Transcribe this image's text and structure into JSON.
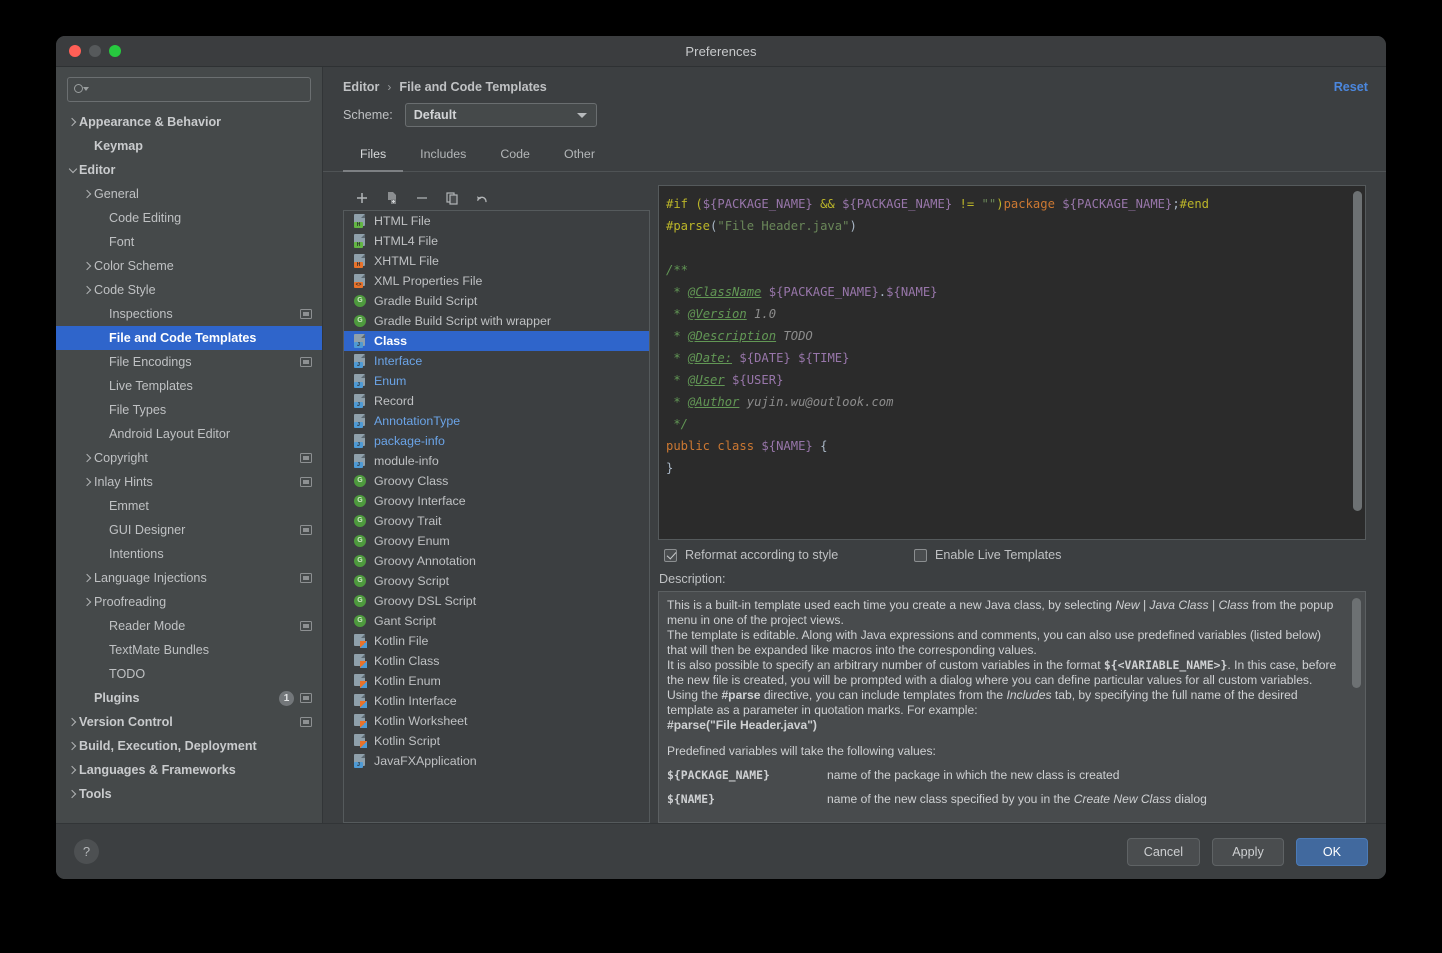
{
  "window": {
    "title": "Preferences",
    "traffic_lights": [
      "close-light",
      "minimize-light",
      "maximize-light"
    ]
  },
  "sidebar": {
    "search": {
      "value": "",
      "placeholder": ""
    },
    "items": [
      {
        "label": "Appearance & Behavior",
        "indent": 0,
        "arrow": "right",
        "bold": true
      },
      {
        "label": "Keymap",
        "indent": 1,
        "arrow": "",
        "bold": true
      },
      {
        "label": "Editor",
        "indent": 0,
        "arrow": "down",
        "bold": true
      },
      {
        "label": "General",
        "indent": 1,
        "arrow": "right"
      },
      {
        "label": "Code Editing",
        "indent": 2,
        "arrow": ""
      },
      {
        "label": "Font",
        "indent": 2,
        "arrow": ""
      },
      {
        "label": "Color Scheme",
        "indent": 1,
        "arrow": "right"
      },
      {
        "label": "Code Style",
        "indent": 1,
        "arrow": "right"
      },
      {
        "label": "Inspections",
        "indent": 2,
        "arrow": "",
        "project": true
      },
      {
        "label": "File and Code Templates",
        "indent": 2,
        "arrow": "",
        "selected": true
      },
      {
        "label": "File Encodings",
        "indent": 2,
        "arrow": "",
        "project": true
      },
      {
        "label": "Live Templates",
        "indent": 2,
        "arrow": ""
      },
      {
        "label": "File Types",
        "indent": 2,
        "arrow": ""
      },
      {
        "label": "Android Layout Editor",
        "indent": 2,
        "arrow": ""
      },
      {
        "label": "Copyright",
        "indent": 1,
        "arrow": "right",
        "project": true
      },
      {
        "label": "Inlay Hints",
        "indent": 1,
        "arrow": "right",
        "project": true
      },
      {
        "label": "Emmet",
        "indent": 2,
        "arrow": ""
      },
      {
        "label": "GUI Designer",
        "indent": 2,
        "arrow": "",
        "project": true
      },
      {
        "label": "Intentions",
        "indent": 2,
        "arrow": ""
      },
      {
        "label": "Language Injections",
        "indent": 1,
        "arrow": "right",
        "project": true
      },
      {
        "label": "Proofreading",
        "indent": 1,
        "arrow": "right"
      },
      {
        "label": "Reader Mode",
        "indent": 2,
        "arrow": "",
        "project": true
      },
      {
        "label": "TextMate Bundles",
        "indent": 2,
        "arrow": ""
      },
      {
        "label": "TODO",
        "indent": 2,
        "arrow": ""
      },
      {
        "label": "Plugins",
        "indent": 1,
        "arrow": "",
        "bold": true,
        "count": "1",
        "project": true
      },
      {
        "label": "Version Control",
        "indent": 0,
        "arrow": "right",
        "bold": true,
        "project": true
      },
      {
        "label": "Build, Execution, Deployment",
        "indent": 0,
        "arrow": "right",
        "bold": true
      },
      {
        "label": "Languages & Frameworks",
        "indent": 0,
        "arrow": "right",
        "bold": true
      },
      {
        "label": "Tools",
        "indent": 0,
        "arrow": "right",
        "bold": true
      }
    ]
  },
  "header": {
    "breadcrumb_parent": "Editor",
    "breadcrumb_sep": "›",
    "breadcrumb_current": "File and Code Templates",
    "reset_label": "Reset",
    "scheme_label": "Scheme:",
    "scheme_value": "Default"
  },
  "tabs": [
    {
      "label": "Files",
      "active": true
    },
    {
      "label": "Includes",
      "active": false
    },
    {
      "label": "Code",
      "active": false
    },
    {
      "label": "Other",
      "active": false
    }
  ],
  "list_toolbar": [
    {
      "icon": "plus-icon",
      "title": "Add"
    },
    {
      "icon": "copy-template-icon",
      "title": "Copy Template"
    },
    {
      "icon": "minus-icon",
      "title": "Remove"
    },
    {
      "icon": "clone-icon",
      "title": "Clone"
    },
    {
      "icon": "reset-undo-icon",
      "title": "Reset to Default"
    }
  ],
  "templates": [
    {
      "label": "HTML File",
      "icon": "html-file-icon",
      "tag": "H",
      "tagcolor": "green",
      "kind": "page"
    },
    {
      "label": "HTML4 File",
      "icon": "html4-file-icon",
      "tag": "H",
      "tagcolor": "green",
      "kind": "page"
    },
    {
      "label": "XHTML File",
      "icon": "xhtml-file-icon",
      "tag": "H",
      "tagcolor": "orange",
      "kind": "page"
    },
    {
      "label": "XML Properties File",
      "icon": "xml-properties-file-icon",
      "tag": "<>",
      "tagcolor": "orange",
      "kind": "page"
    },
    {
      "label": "Gradle Build Script",
      "icon": "groovy-icon",
      "kind": "circle",
      "tag": "G"
    },
    {
      "label": "Gradle Build Script with wrapper",
      "icon": "groovy-icon",
      "kind": "circle",
      "tag": "G"
    },
    {
      "label": "Class",
      "icon": "java-class-icon",
      "tag": "J",
      "tagcolor": "blue",
      "kind": "page",
      "selected": true
    },
    {
      "label": "Interface",
      "icon": "java-interface-icon",
      "tag": "J",
      "tagcolor": "blue",
      "kind": "page",
      "blue": true
    },
    {
      "label": "Enum",
      "icon": "java-enum-icon",
      "tag": "J",
      "tagcolor": "blue",
      "kind": "page",
      "blue": true
    },
    {
      "label": "Record",
      "icon": "java-record-icon",
      "tag": "J",
      "tagcolor": "blue",
      "kind": "page"
    },
    {
      "label": "AnnotationType",
      "icon": "java-annotation-icon",
      "tag": "J",
      "tagcolor": "blue",
      "kind": "page",
      "blue": true
    },
    {
      "label": "package-info",
      "icon": "java-package-info-icon",
      "tag": "J",
      "tagcolor": "blue",
      "kind": "page",
      "blue": true
    },
    {
      "label": "module-info",
      "icon": "java-module-info-icon",
      "tag": "J",
      "tagcolor": "blue",
      "kind": "page"
    },
    {
      "label": "Groovy Class",
      "icon": "groovy-icon",
      "kind": "circle",
      "tag": "G"
    },
    {
      "label": "Groovy Interface",
      "icon": "groovy-icon",
      "kind": "circle",
      "tag": "G"
    },
    {
      "label": "Groovy Trait",
      "icon": "groovy-icon",
      "kind": "circle",
      "tag": "G"
    },
    {
      "label": "Groovy Enum",
      "icon": "groovy-icon",
      "kind": "circle",
      "tag": "G"
    },
    {
      "label": "Groovy Annotation",
      "icon": "groovy-icon",
      "kind": "circle",
      "tag": "G"
    },
    {
      "label": "Groovy Script",
      "icon": "groovy-icon",
      "kind": "circle",
      "tag": "G"
    },
    {
      "label": "Groovy DSL Script",
      "icon": "groovy-icon",
      "kind": "circle",
      "tag": "G"
    },
    {
      "label": "Gant Script",
      "icon": "groovy-icon",
      "kind": "circle",
      "tag": "G"
    },
    {
      "label": "Kotlin File",
      "icon": "kotlin-file-icon",
      "kind": "kotlin"
    },
    {
      "label": "Kotlin Class",
      "icon": "kotlin-class-icon",
      "kind": "kotlin"
    },
    {
      "label": "Kotlin Enum",
      "icon": "kotlin-enum-icon",
      "kind": "kotlin"
    },
    {
      "label": "Kotlin Interface",
      "icon": "kotlin-interface-icon",
      "kind": "kotlin"
    },
    {
      "label": "Kotlin Worksheet",
      "icon": "kotlin-worksheet-icon",
      "kind": "kotlin"
    },
    {
      "label": "Kotlin Script",
      "icon": "kotlin-script-icon",
      "kind": "kotlin"
    },
    {
      "label": "JavaFXApplication",
      "icon": "javafx-application-icon",
      "tag": "J",
      "tagcolor": "blue",
      "kind": "page"
    }
  ],
  "editor": {
    "code_lines": [
      [
        {
          "t": "#if (",
          "c": "k-dir"
        },
        {
          "t": "${PACKAGE_NAME}",
          "c": "k-var"
        },
        {
          "t": " && ",
          "c": "k-dir"
        },
        {
          "t": "${PACKAGE_NAME}",
          "c": "k-var"
        },
        {
          "t": " != ",
          "c": "k-dir"
        },
        {
          "t": "\"\"",
          "c": "k-str"
        },
        {
          "t": ")",
          "c": "k-dir"
        },
        {
          "t": "package ",
          "c": "k-kw"
        },
        {
          "t": "${PACKAGE_NAME}",
          "c": "k-var"
        },
        {
          "t": ";",
          "c": "k-plain"
        },
        {
          "t": "#end",
          "c": "k-dir"
        }
      ],
      [
        {
          "t": "#parse",
          "c": "k-dir"
        },
        {
          "t": "(",
          "c": "k-plain"
        },
        {
          "t": "\"File Header.java\"",
          "c": "k-str"
        },
        {
          "t": ")",
          "c": "k-plain"
        }
      ],
      [],
      [
        {
          "t": "/**",
          "c": "k-cmt"
        }
      ],
      [
        {
          "t": " * ",
          "c": "k-cmt"
        },
        {
          "t": "@ClassName",
          "c": "k-tag"
        },
        {
          "t": " ",
          "c": "k-doc"
        },
        {
          "t": "${PACKAGE_NAME}",
          "c": "k-var"
        },
        {
          "t": ".",
          "c": "k-plain"
        },
        {
          "t": "${NAME}",
          "c": "k-var"
        }
      ],
      [
        {
          "t": " * ",
          "c": "k-cmt"
        },
        {
          "t": "@Version",
          "c": "k-tag"
        },
        {
          "t": " 1.0",
          "c": "k-doc"
        }
      ],
      [
        {
          "t": " * ",
          "c": "k-cmt"
        },
        {
          "t": "@Description",
          "c": "k-tag"
        },
        {
          "t": " TODO",
          "c": "k-doc"
        }
      ],
      [
        {
          "t": " * ",
          "c": "k-cmt"
        },
        {
          "t": "@Date:",
          "c": "k-tag"
        },
        {
          "t": " ",
          "c": "k-doc"
        },
        {
          "t": "${DATE}",
          "c": "k-var"
        },
        {
          "t": " ",
          "c": "k-doc"
        },
        {
          "t": "${TIME}",
          "c": "k-var"
        }
      ],
      [
        {
          "t": " * ",
          "c": "k-cmt"
        },
        {
          "t": "@User",
          "c": "k-tag"
        },
        {
          "t": " ",
          "c": "k-doc"
        },
        {
          "t": "${USER}",
          "c": "k-var"
        }
      ],
      [
        {
          "t": " * ",
          "c": "k-cmt"
        },
        {
          "t": "@Author",
          "c": "k-tag"
        },
        {
          "t": " yujin.wu@outlook.com",
          "c": "k-doc"
        }
      ],
      [
        {
          "t": " */",
          "c": "k-cmt"
        }
      ],
      [
        {
          "t": "public class ",
          "c": "k-kw"
        },
        {
          "t": "${NAME}",
          "c": "k-var"
        },
        {
          "t": " {",
          "c": "k-plain"
        }
      ],
      [
        {
          "t": "}",
          "c": "k-plain"
        }
      ]
    ],
    "checkbox_reformat": {
      "label": "Reformat according to style",
      "checked": true
    },
    "checkbox_live_templates": {
      "label": "Enable Live Templates",
      "checked": false
    },
    "description_label": "Description:"
  },
  "description": {
    "p1_a": "This is a built-in template used each time you create a new Java class, by selecting ",
    "p1_i1": "New | Java Class | Class",
    "p1_b": " from the popup menu in one of the project views.",
    "p2": "The template is editable. Along with Java expressions and comments, you can also use predefined variables (listed below) that will then be expanded like macros into the corresponding values.",
    "p3_a": "It is also possible to specify an arbitrary number of custom variables in the format ",
    "p3_code": "${<VARIABLE_NAME>}",
    "p3_b": ". In this case, before the new file is created, you will be prompted with a dialog where you can define particular values for all custom variables.",
    "p4_a": "Using the ",
    "p4_code": "#parse",
    "p4_b": " directive, you can include templates from the ",
    "p4_i": "Includes",
    "p4_c": " tab, by specifying the full name of the desired template as a parameter in quotation marks. For example:",
    "p5_code": "#parse(\"File Header.java\")",
    "p6": "Predefined variables will take the following values:",
    "vars": [
      {
        "name": "${PACKAGE_NAME}",
        "desc_a": "name of the package in which the new class is created",
        "desc_i": "",
        "desc_b": ""
      },
      {
        "name": "${NAME}",
        "desc_a": "name of the new class specified by you in the ",
        "desc_i": "Create New Class",
        "desc_b": " dialog"
      }
    ]
  },
  "footer": {
    "help_label": "?",
    "cancel_label": "Cancel",
    "apply_label": "Apply",
    "ok_label": "OK"
  },
  "colors": {
    "accent_selection": "#2f65cb",
    "link_blue": "#4b87de",
    "primary_button": "#41699e",
    "editor_bg": "#2b2b2b",
    "window_bg": "#3c3f41",
    "sidebar_bg": "#45494a"
  }
}
